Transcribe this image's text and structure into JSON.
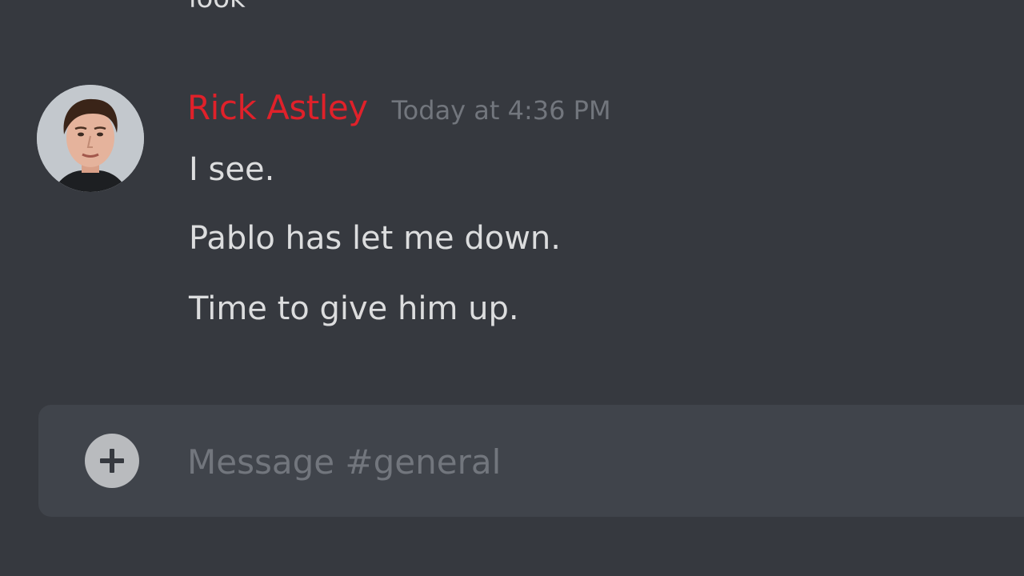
{
  "previous_message": {
    "text": "look"
  },
  "message": {
    "author": "Rick Astley",
    "author_color": "#e0212a",
    "timestamp": "Today at 4:36 PM",
    "lines": [
      "I see.",
      "Pablo has let me down.",
      "Time to give him up."
    ]
  },
  "composer": {
    "add_icon": "plus-circle-icon",
    "placeholder": "Message #general"
  },
  "colors": {
    "background": "#36393f",
    "composer_background": "#40444b",
    "text": "#dcddde",
    "muted": "#72767d"
  }
}
